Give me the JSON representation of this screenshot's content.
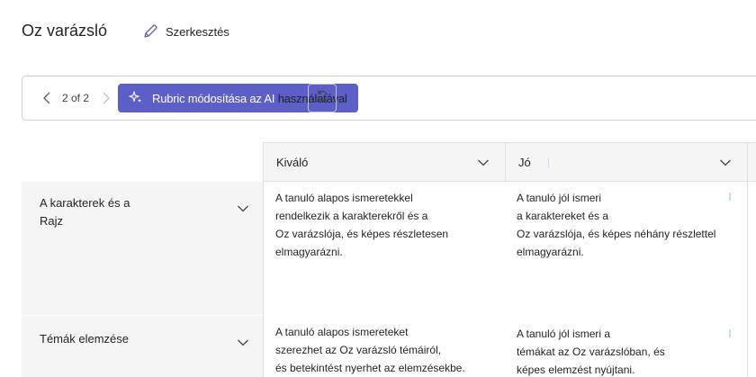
{
  "header": {
    "title": "Oz varázsló",
    "edit_label": "Szerkesztés"
  },
  "toolbar": {
    "pager": "2 of 2",
    "ai_button_label": "Rubric módosítása az AI",
    "ai_button_overflow": " használatával"
  },
  "columns": [
    {
      "label": "Kiváló"
    },
    {
      "label": "Jó"
    }
  ],
  "rows": [
    {
      "label": "A karakterek és a\nRajz",
      "cells": [
        "A tanuló alapos ismeretekkel\nrendelkezik a karakterekről és a\nOz varázslója, és képes részletesen\nelmagyarázni.",
        "A tanuló jól ismeri\na karaktereket és a\nOz varázslója, és képes néhány részlettel\nelmagyarázni."
      ]
    },
    {
      "label": "Témák elemzése",
      "cells": [
        "A tanuló alapos ismereteket\nszerezhet az Oz varázsló témáiról,\nés betekintést nyerhet az elemzésekbe.",
        "A tanuló jól ismeri a\ntémákat az Oz varázslóban, és\nképes elemzést nyújtani."
      ]
    }
  ]
}
